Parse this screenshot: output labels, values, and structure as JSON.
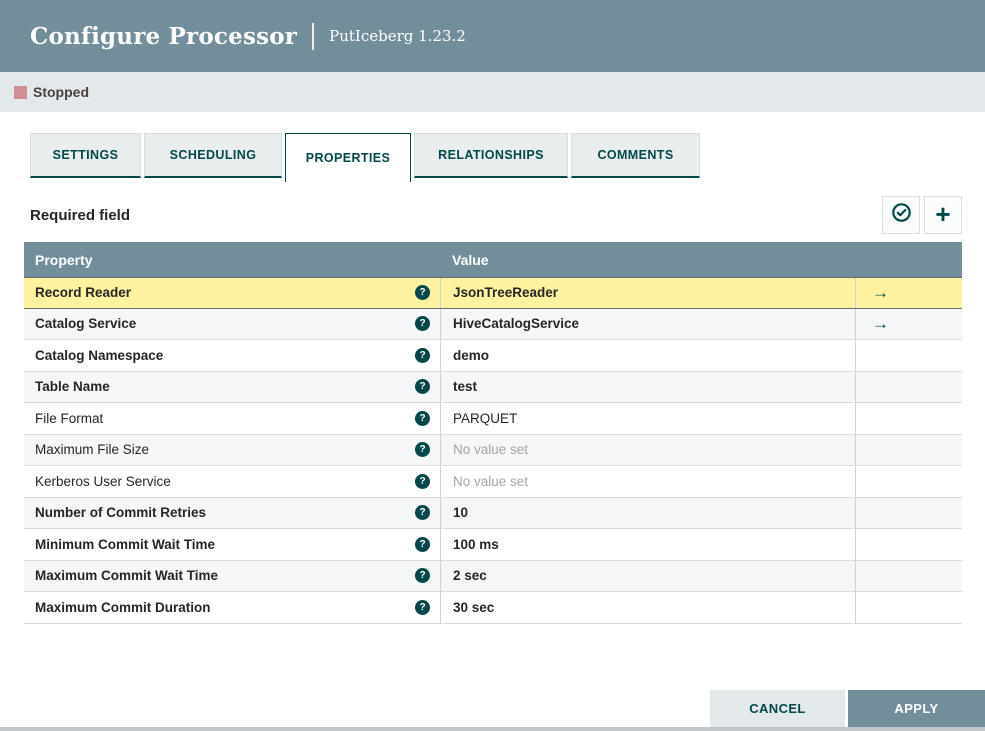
{
  "dialog": {
    "title": "Configure Processor",
    "subtitle": "PutIceberg 1.23.2"
  },
  "status": {
    "label": "Stopped",
    "color": "#cf8f95"
  },
  "tabs": [
    {
      "label": "SETTINGS",
      "active": false
    },
    {
      "label": "SCHEDULING",
      "active": false
    },
    {
      "label": "PROPERTIES",
      "active": true
    },
    {
      "label": "RELATIONSHIPS",
      "active": false
    },
    {
      "label": "COMMENTS",
      "active": false
    }
  ],
  "properties_panel": {
    "required_note": "Required field",
    "verify_button_icon": "check-circle-icon",
    "add_button_icon": "plus-icon",
    "add_glyph": "+"
  },
  "table": {
    "columns": {
      "property": "Property",
      "value": "Value"
    },
    "help_glyph": "?",
    "link_glyph": "→",
    "rows": [
      {
        "property": "Record Reader",
        "value": "JsonTreeReader",
        "required": true,
        "selected": true,
        "link": true,
        "value_set": true
      },
      {
        "property": "Catalog Service",
        "value": "HiveCatalogService",
        "required": true,
        "selected": false,
        "link": true,
        "value_set": true
      },
      {
        "property": "Catalog Namespace",
        "value": "demo",
        "required": true,
        "selected": false,
        "link": false,
        "value_set": true
      },
      {
        "property": "Table Name",
        "value": "test",
        "required": true,
        "selected": false,
        "link": false,
        "value_set": true
      },
      {
        "property": "File Format",
        "value": "PARQUET",
        "required": false,
        "selected": false,
        "link": false,
        "value_set": true
      },
      {
        "property": "Maximum File Size",
        "value": "No value set",
        "required": false,
        "selected": false,
        "link": false,
        "value_set": false
      },
      {
        "property": "Kerberos User Service",
        "value": "No value set",
        "required": false,
        "selected": false,
        "link": false,
        "value_set": false
      },
      {
        "property": "Number of Commit Retries",
        "value": "10",
        "required": true,
        "selected": false,
        "link": false,
        "value_set": true
      },
      {
        "property": "Minimum Commit Wait Time",
        "value": "100 ms",
        "required": true,
        "selected": false,
        "link": false,
        "value_set": true
      },
      {
        "property": "Maximum Commit Wait Time",
        "value": "2 sec",
        "required": true,
        "selected": false,
        "link": false,
        "value_set": true
      },
      {
        "property": "Maximum Commit Duration",
        "value": "30 sec",
        "required": true,
        "selected": false,
        "link": false,
        "value_set": true
      }
    ]
  },
  "footer": {
    "cancel_label": "CANCEL",
    "apply_label": "APPLY"
  },
  "colors": {
    "header": "#728e9b",
    "accent_teal": "#004849",
    "status_bar_bg": "#e3e8eb",
    "selected_row": "#fcf2a0",
    "alt_row": "#f4f6f7"
  }
}
